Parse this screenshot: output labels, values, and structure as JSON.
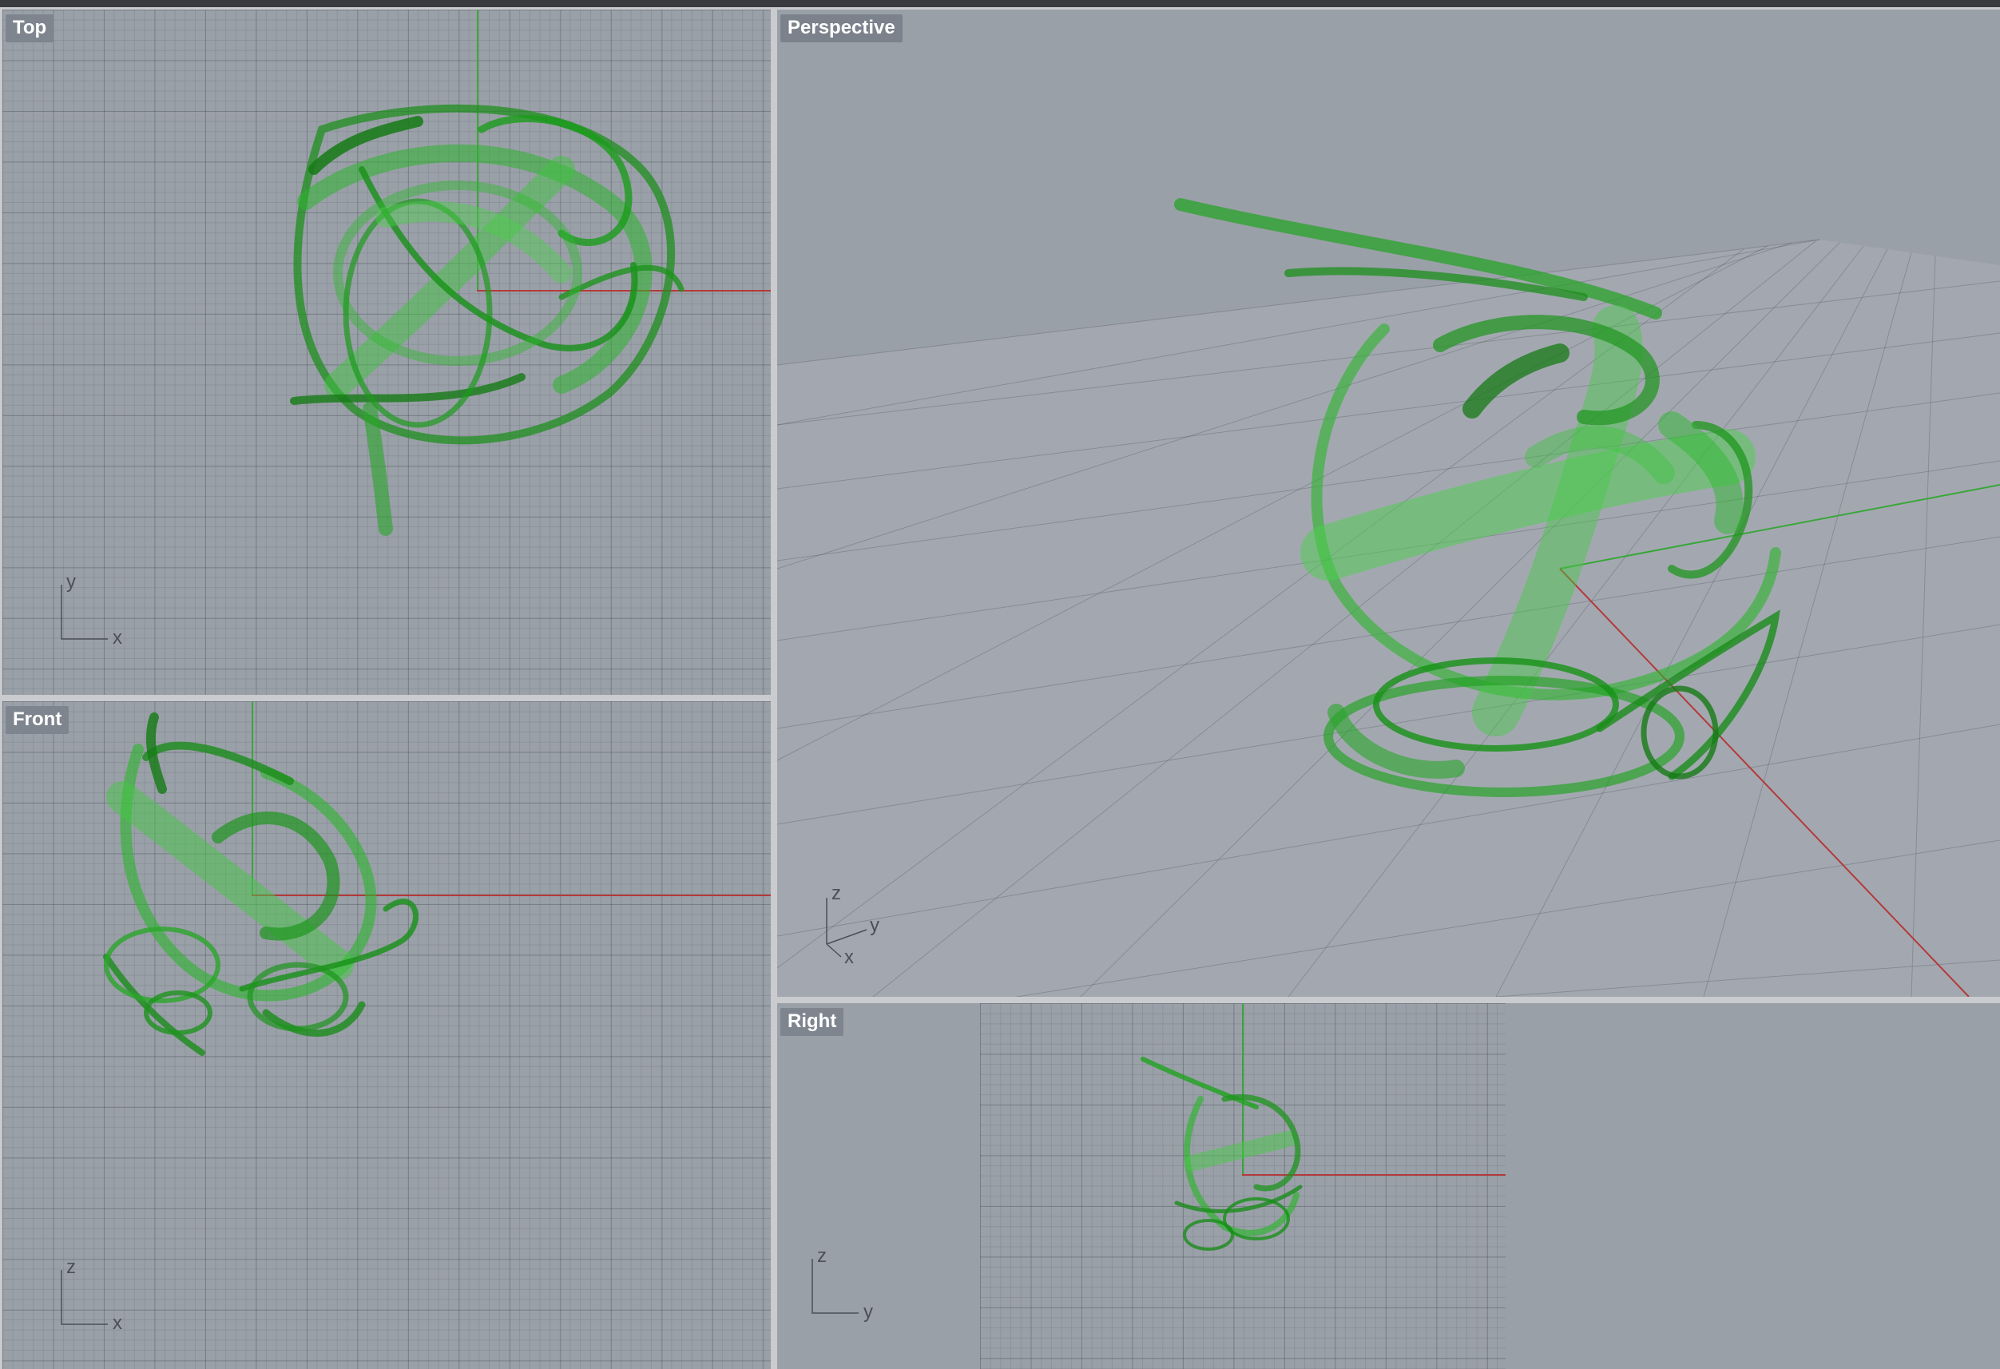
{
  "viewports": {
    "top": {
      "label": "Top",
      "axis_h": "x",
      "axis_v": "y"
    },
    "front": {
      "label": "Front",
      "axis_h": "x",
      "axis_v": "z"
    },
    "perspective": {
      "label": "Perspective",
      "axis_a": "z",
      "axis_b": "y",
      "axis_c": "x"
    },
    "right": {
      "label": "Right",
      "axis_h": "y",
      "axis_v": "z"
    }
  },
  "colors": {
    "background": "#9aa0a8",
    "object_green": "#1fb81f",
    "x_axis": "#b33a3a",
    "y_axis": "#3aa63a",
    "label_bg": "#7f858e"
  }
}
